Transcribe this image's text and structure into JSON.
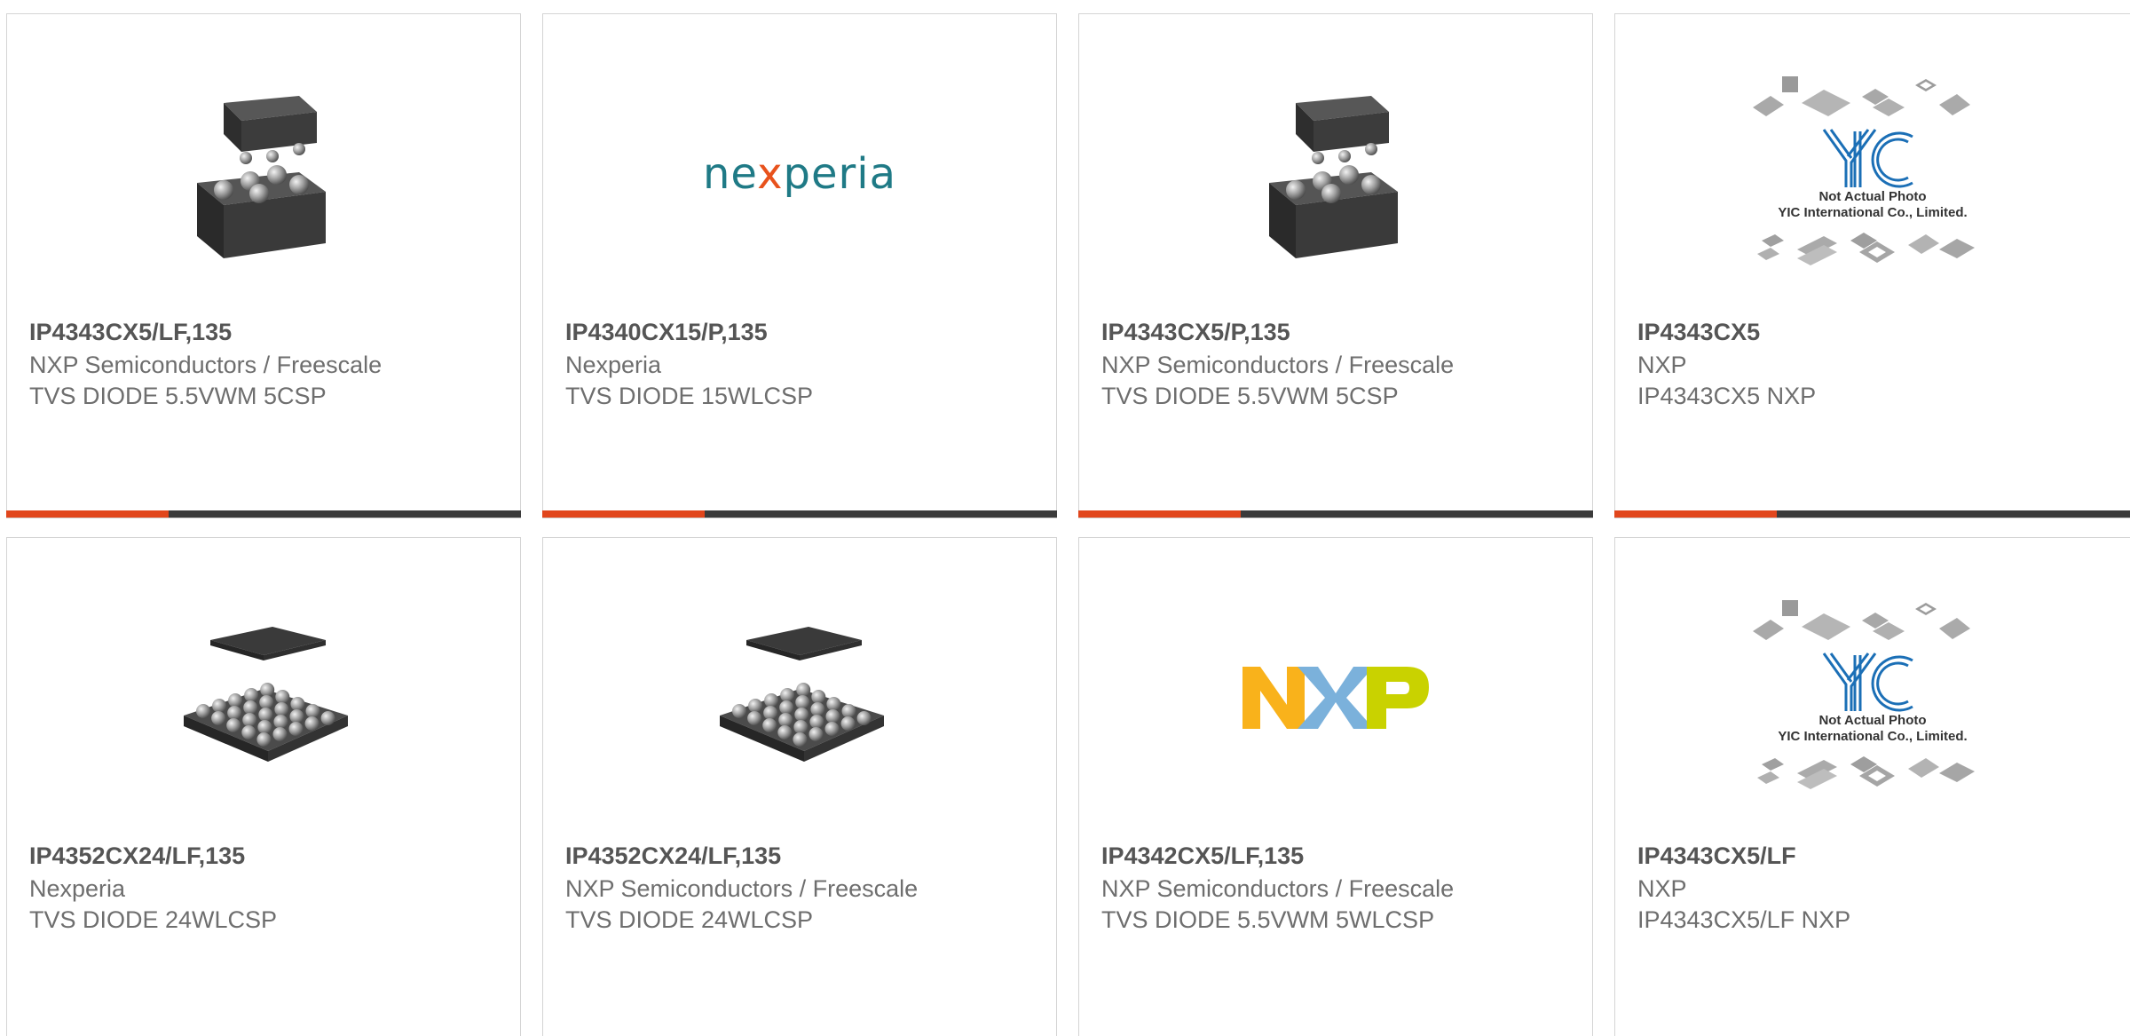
{
  "products": [
    {
      "part_number": "IP4343CX5/LF,135",
      "manufacturer": "NXP Semiconductors / Freescale",
      "description": "TVS DIODE 5.5VWM 5CSP",
      "image": "chip-5csp-icon"
    },
    {
      "part_number": "IP4340CX15/P,135",
      "manufacturer": "Nexperia",
      "description": "TVS DIODE 15WLCSP",
      "image": "nexperia-logo",
      "logo_text_pre": "ne",
      "logo_text_x": "x",
      "logo_text_post": "peria"
    },
    {
      "part_number": "IP4343CX5/P,135",
      "manufacturer": "NXP Semiconductors / Freescale",
      "description": "TVS DIODE 5.5VWM 5CSP",
      "image": "chip-5csp-icon"
    },
    {
      "part_number": "IP4343CX5",
      "manufacturer": "NXP",
      "description": "IP4343CX5 NXP",
      "image": "yic-placeholder-icon",
      "placeholder_line1": "Not Actual Photo",
      "placeholder_line2": "YIC International Co., Limited."
    },
    {
      "part_number": "IP4352CX24/LF,135",
      "manufacturer": "Nexperia",
      "description": "TVS DIODE 24WLCSP",
      "image": "chip-24wlcsp-icon"
    },
    {
      "part_number": "IP4352CX24/LF,135",
      "manufacturer": "NXP Semiconductors / Freescale",
      "description": "TVS DIODE 24WLCSP",
      "image": "chip-24wlcsp-icon"
    },
    {
      "part_number": "IP4342CX5/LF,135",
      "manufacturer": "NXP Semiconductors / Freescale",
      "description": "TVS DIODE 5.5VWM 5WLCSP",
      "image": "nxp-logo"
    },
    {
      "part_number": "IP4343CX5/LF",
      "manufacturer": "NXP",
      "description": "IP4343CX5/LF NXP",
      "image": "yic-placeholder-icon",
      "placeholder_line1": "Not Actual Photo",
      "placeholder_line2": "YIC International Co., Limited."
    }
  ],
  "colors": {
    "accent": "#e1461c",
    "bar": "#3b3b3b",
    "border": "#d4d4d4",
    "nexperia_teal": "#1f7a86",
    "nexperia_orange": "#e8521c",
    "nxp_orange": "#f9b21b",
    "nxp_blue": "#7bb1db",
    "nxp_green": "#c9d200",
    "yic_blue": "#1b6fb6"
  }
}
